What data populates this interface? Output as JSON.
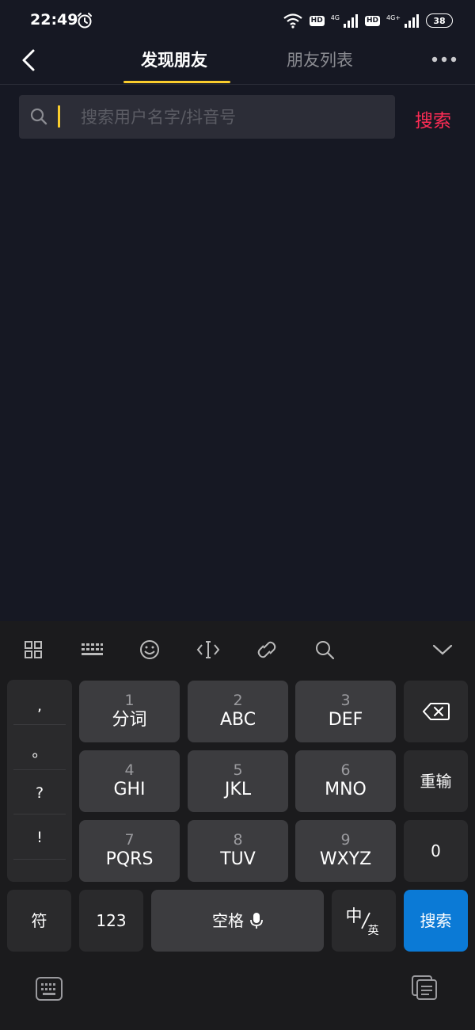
{
  "status_bar": {
    "time": "22:49",
    "hd1": "HD",
    "net1": "4G",
    "hd2": "HD",
    "net2": "4G+",
    "battery": "38",
    "icons": [
      "alarm-icon",
      "wifi-icon",
      "signal-icon",
      "battery-icon"
    ]
  },
  "header": {
    "tabs": [
      {
        "label": "发现朋友",
        "active": true
      },
      {
        "label": "朋友列表",
        "active": false
      }
    ],
    "accent_color": "#facd2d"
  },
  "search": {
    "placeholder": "搜索用户名字/抖音号",
    "button_label": "搜索",
    "button_color": "#fe2c55"
  },
  "keyboard": {
    "toolbar": [
      "apps-icon",
      "keyboard-layout-icon",
      "emoji-icon",
      "cursor-icon",
      "clipboard-link-icon",
      "search-icon",
      "collapse-icon"
    ],
    "punctuation": [
      ",",
      "。",
      "?",
      "!"
    ],
    "keys": [
      {
        "num": "1",
        "label": "分词"
      },
      {
        "num": "2",
        "label": "ABC"
      },
      {
        "num": "3",
        "label": "DEF"
      },
      {
        "num": "4",
        "label": "GHI"
      },
      {
        "num": "5",
        "label": "JKL"
      },
      {
        "num": "6",
        "label": "MNO"
      },
      {
        "num": "7",
        "label": "PQRS"
      },
      {
        "num": "8",
        "label": "TUV"
      },
      {
        "num": "9",
        "label": "WXYZ"
      }
    ],
    "reenter_label": "重输",
    "zero_label": "0",
    "symbol_label": "符",
    "num_label": "123",
    "space_label": "空格",
    "lang_main": "中",
    "lang_sub": "英",
    "search_label": "搜索",
    "search_color": "#0b7ad6"
  }
}
